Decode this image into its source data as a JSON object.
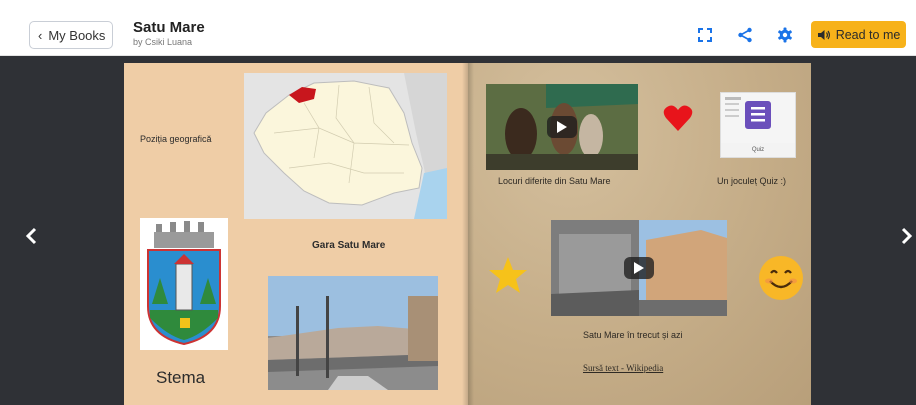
{
  "header": {
    "back_label": "My Books",
    "title": "Satu Mare",
    "byline": "by Csiki Luana",
    "read_label": "Read to me"
  },
  "icons": {
    "fullscreen": "fullscreen-icon",
    "share": "share-icon",
    "settings": "gear-icon",
    "speaker": "speaker-icon"
  },
  "colors": {
    "accent": "#1a73e8",
    "read_button": "#f7b21a",
    "stage": "#2f3136",
    "page_left": "#efcda6",
    "page_right": "#c9b18e"
  },
  "left_page": {
    "position_label": "Poziția geografică",
    "station_label": "Gara Satu Mare",
    "coat_label": "Stema"
  },
  "right_page": {
    "video1_caption": "Locuri diferite din Satu Mare",
    "quiz_caption": "Un joculeț Quiz :)",
    "quiz_card_label": "Quiz",
    "video2_caption": "Satu Mare în trecut și azi",
    "source_link": "Sursă text - Wikipedia"
  }
}
